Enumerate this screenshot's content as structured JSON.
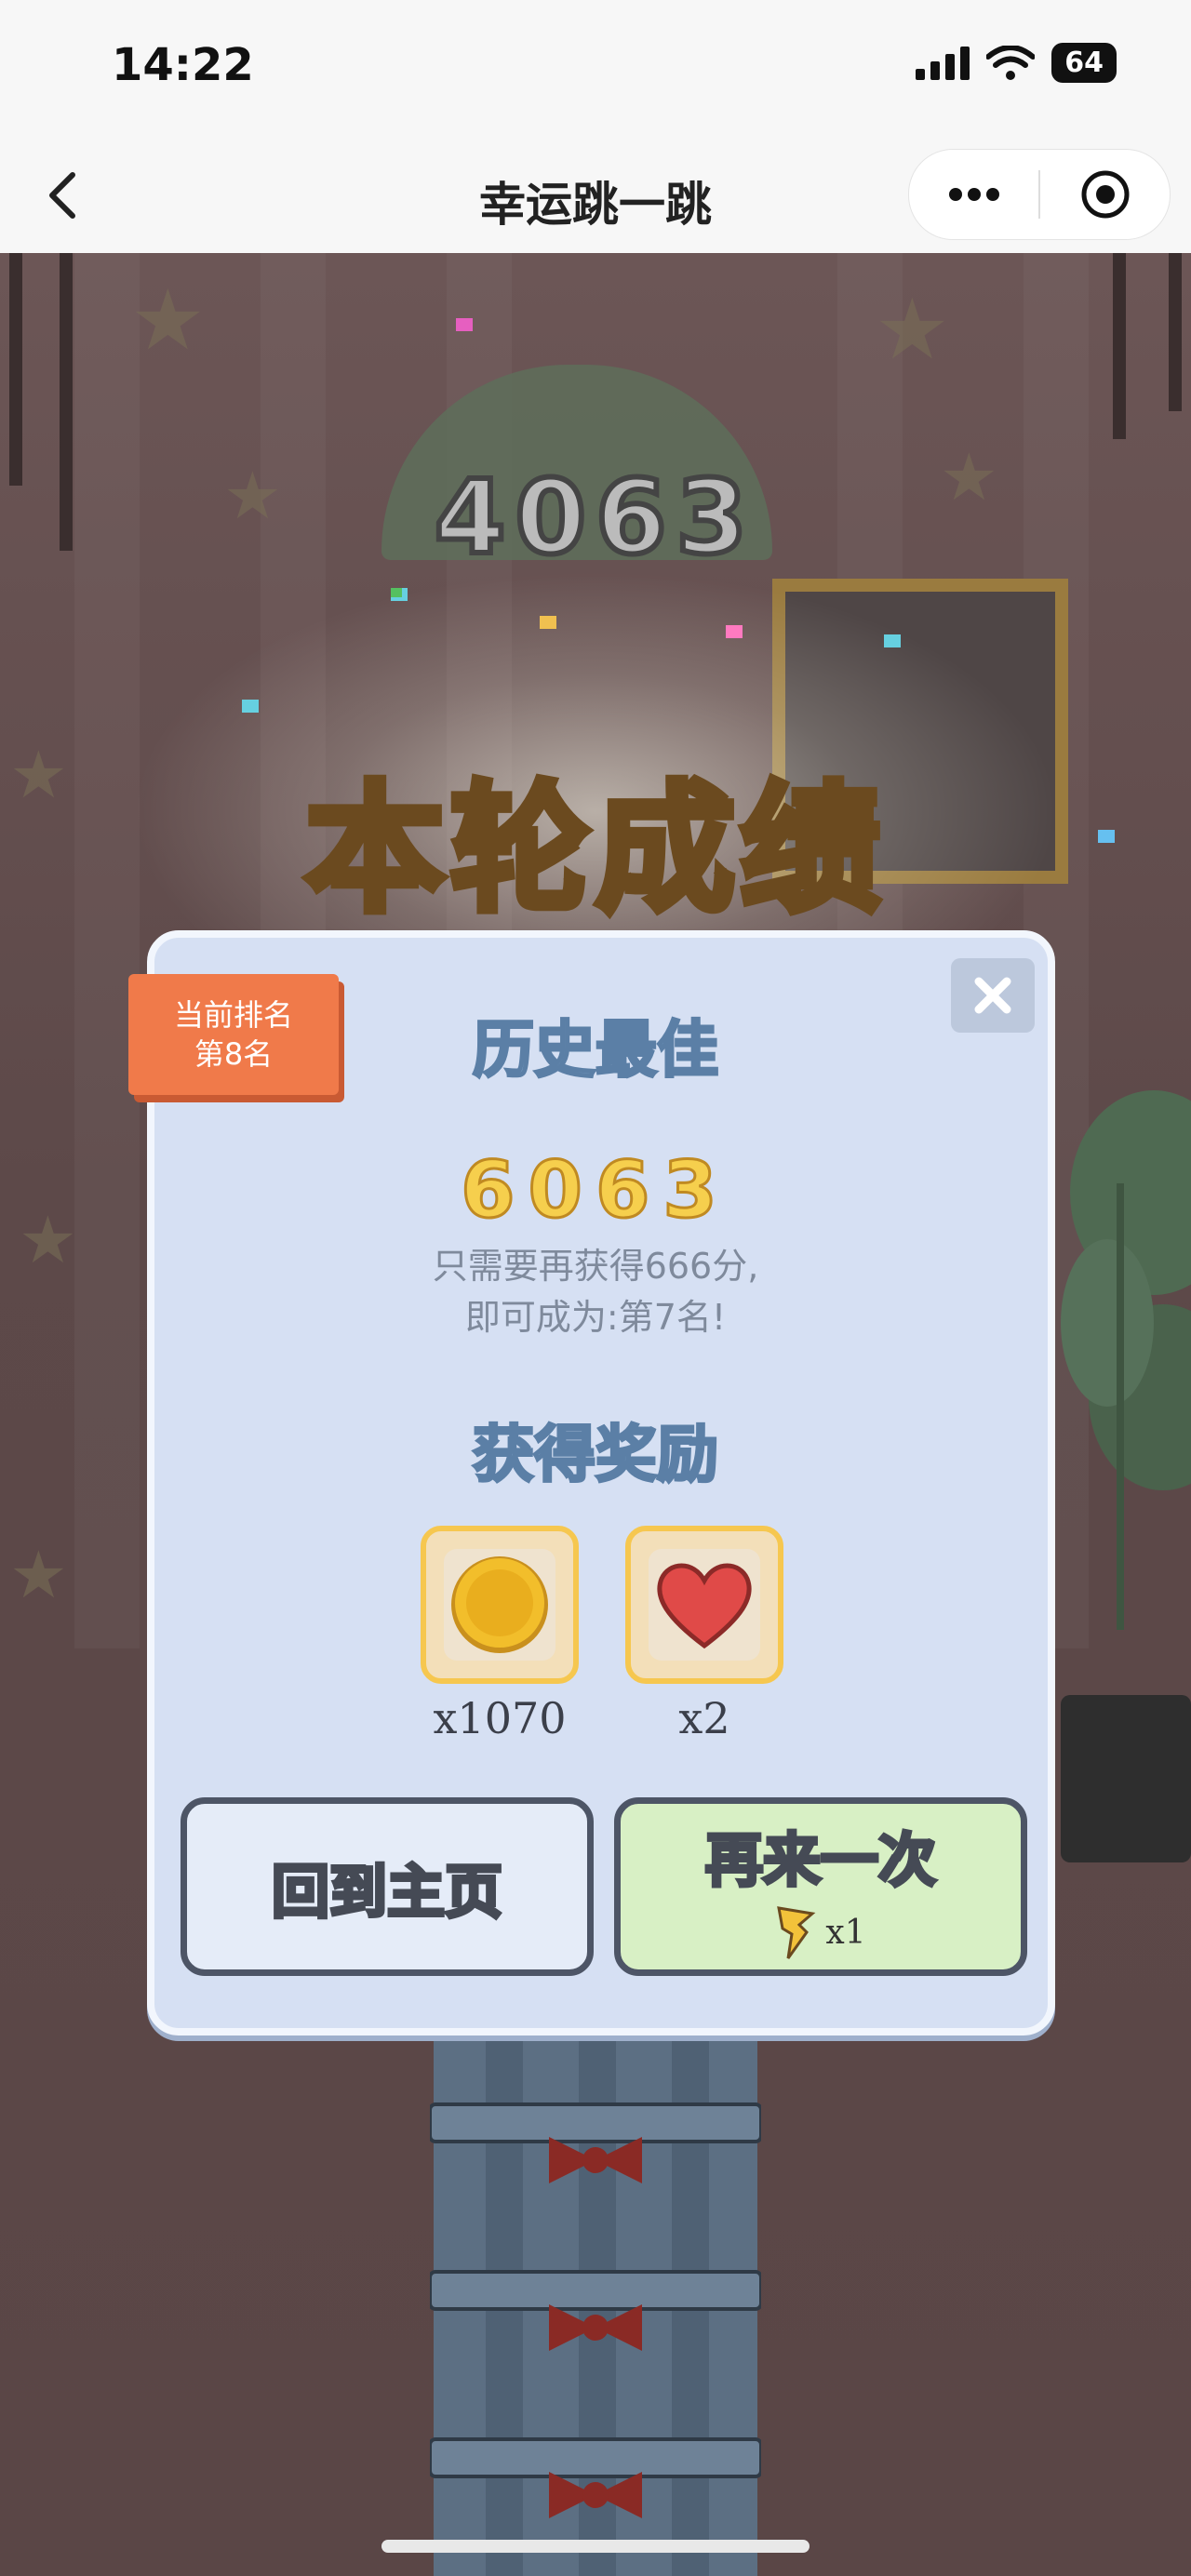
{
  "status_bar": {
    "time": "14:22",
    "battery": "64"
  },
  "nav": {
    "title": "幸运跳一跳"
  },
  "scene": {
    "floating_score": "4063",
    "banner": "本轮成绩"
  },
  "modal": {
    "rank_line1": "当前排名",
    "rank_line2": "第8名",
    "best_title": "历史最佳",
    "best_score": "6063",
    "hint_line1": "只需要再获得666分,",
    "hint_line2": "即可成为:第7名!",
    "reward_title": "获得奖励",
    "rewards": [
      {
        "icon": "coin-icon",
        "count": "x1070"
      },
      {
        "icon": "heart-icon",
        "count": "x2"
      }
    ],
    "home_button": "回到主页",
    "retry_button": "再来一次",
    "retry_cost": "x1"
  },
  "colors": {
    "accent_gold": "#ffd76a",
    "rank_tag": "#f07a4a",
    "modal_bg": "#d6e0f3",
    "retry_bg": "#d8f0c5"
  }
}
